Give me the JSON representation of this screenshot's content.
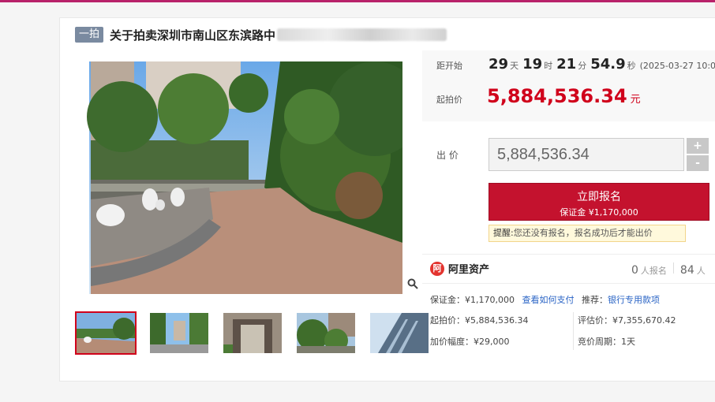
{
  "colors": {
    "accent": "#c4122e",
    "price": "#d0021b",
    "top_bar": "#b8226a",
    "link": "#2a64c5"
  },
  "header": {
    "badge": "一拍",
    "title": "关于拍卖深圳市南山区东滨路中"
  },
  "countdown": {
    "label": "距开始",
    "days": "29",
    "days_unit": "天",
    "hours": "19",
    "hours_unit": "时",
    "minutes": "21",
    "minutes_unit": "分",
    "seconds": "54.9",
    "seconds_unit": "秒",
    "start_date": "(2025-03-27 10:0"
  },
  "start_price": {
    "label": "起拍价",
    "value": "5,884,536.34",
    "unit": "元"
  },
  "bid": {
    "label": "出 价",
    "value": "5,884,536.34",
    "plus": "+",
    "minus": "-"
  },
  "signup": {
    "label": "立即报名",
    "deposit": "保证金 ¥1,170,000"
  },
  "reminder": {
    "prefix": "提醒:",
    "text": "您还没有报名，报名成功后才能出价"
  },
  "platform": {
    "logo_glyph": "阿",
    "name": "阿里资产"
  },
  "stats": {
    "signups": "0",
    "signups_label": "人报名",
    "watchers": "84",
    "watchers_label": "人"
  },
  "deposit_row": {
    "text": "保证金：¥1,170,000",
    "link": "查看如何支付",
    "rec_label": "推荐：",
    "rec_link": "银行专用款项"
  },
  "details": {
    "start_price": "起拍价：¥5,884,536.34",
    "appraisal": "评估价：¥7,355,670.42",
    "increment": "加价幅度：¥29,000",
    "cycle": "竞价周期：1天"
  },
  "icons": {
    "zoom": "magnifier-icon"
  }
}
